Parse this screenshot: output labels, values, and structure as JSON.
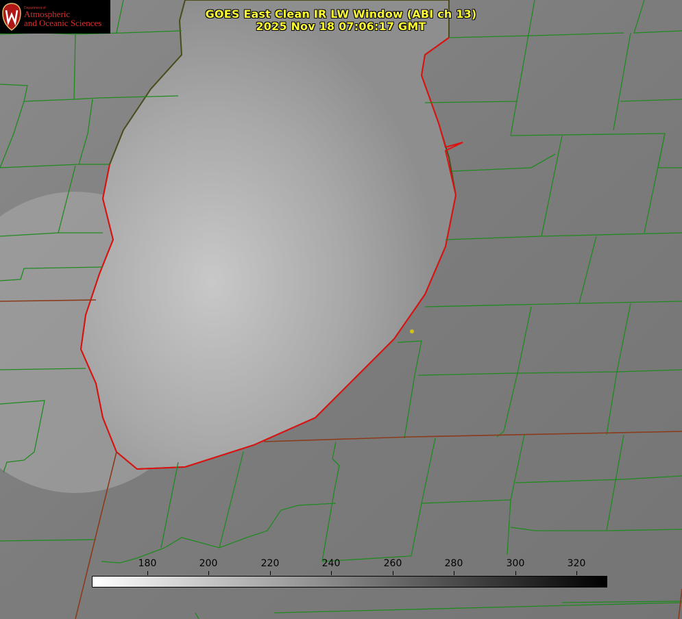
{
  "title": {
    "line1": "GOES East Clean IR LW Window (ABI ch 13)",
    "line2": "2025 Nov 18 07:06:17 GMT"
  },
  "logo": {
    "dept": "Department of",
    "line1": "Atmospheric",
    "line2": "and Oceanic Sciences"
  },
  "colorbar": {
    "ticks": [
      "180",
      "200",
      "220",
      "240",
      "260",
      "280",
      "300",
      "320"
    ],
    "gradient_start": "#ffffff",
    "gradient_end": "#000000"
  },
  "colors": {
    "title_text": "#ffff33",
    "county_lines": "#1f8a1f",
    "state_lines": "#8b3a1a",
    "shoreline_highlight": "#e01010",
    "marker": "#d4c21a"
  }
}
